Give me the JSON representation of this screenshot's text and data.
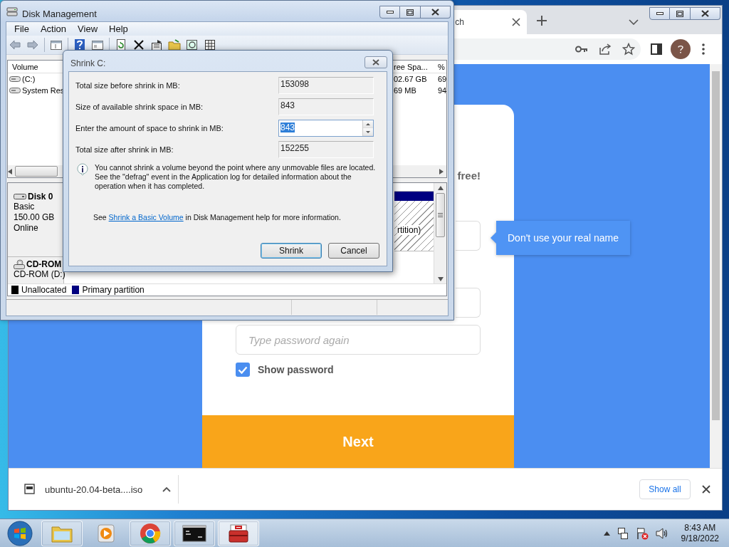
{
  "disk_management": {
    "title": "Disk Management",
    "menu": [
      "File",
      "Action",
      "View",
      "Help"
    ],
    "volume_list": {
      "columns": [
        "Volume",
        "ree Spa...",
        "%"
      ],
      "rows": [
        {
          "volume": "(C:)",
          "free_space": "02.67 GB",
          "percent_free": "69"
        },
        {
          "volume": "System Res",
          "free_space": "69 MB",
          "percent_free": "94"
        }
      ]
    },
    "disks": [
      {
        "kind": "disk",
        "name": "Disk 0",
        "details": [
          "Basic",
          "150.00 GB",
          "Online"
        ]
      },
      {
        "kind": "cdrom",
        "name": "CD-ROM",
        "details": [
          "CD-ROM (D:)"
        ]
      }
    ],
    "partition_label": "rtition)",
    "legend": [
      {
        "label": "Unallocated",
        "color": "#000000"
      },
      {
        "label": "Primary partition",
        "color": "#000080"
      }
    ]
  },
  "shrink_dialog": {
    "title": "Shrink C:",
    "rows": [
      {
        "kind": "readonly",
        "label": "Total size before shrink in MB:",
        "value": "153098"
      },
      {
        "kind": "readonly",
        "label": "Size of available shrink space in MB:",
        "value": "843"
      },
      {
        "kind": "spin",
        "label": "Enter the amount of space to shrink in MB:",
        "value": "843",
        "text_selected": true
      },
      {
        "kind": "readonly",
        "label": "Total size after shrink in MB:",
        "value": "152255"
      }
    ],
    "info": "You cannot shrink a volume beyond the point where any unmovable files are located. See the \"defrag\" event in the Application log for detailed information about the operation when it has completed.",
    "help": {
      "before": "See",
      "link": "Shrink a Basic Volume",
      "after": "in Disk Management help for more information."
    },
    "buttons": [
      {
        "label": "Shrink",
        "default": true
      },
      {
        "label": "Cancel",
        "default": false
      }
    ]
  },
  "browser": {
    "tab_title": "ch",
    "page": {
      "heading_end": "free!",
      "tooltip": "Don't use your real name",
      "confirm_password": {
        "placeholder": "Type password again"
      },
      "show_password": {
        "label": "Show password",
        "checked": true
      },
      "next_button": "Next"
    },
    "download": {
      "file": "ubuntu-20.04-beta....iso",
      "show_all": "Show all"
    }
  },
  "taskbar": {
    "apps": [
      {
        "kind": "explorer",
        "running": true,
        "selected": false
      },
      {
        "kind": "media",
        "running": false,
        "selected": false
      },
      {
        "kind": "browser",
        "running": true,
        "selected": false
      },
      {
        "kind": "terminal",
        "running": true,
        "selected": false
      },
      {
        "kind": "toolbox",
        "running": true,
        "selected": true
      }
    ],
    "clock": {
      "time": "8:43 AM",
      "date": "9/18/2022"
    }
  }
}
